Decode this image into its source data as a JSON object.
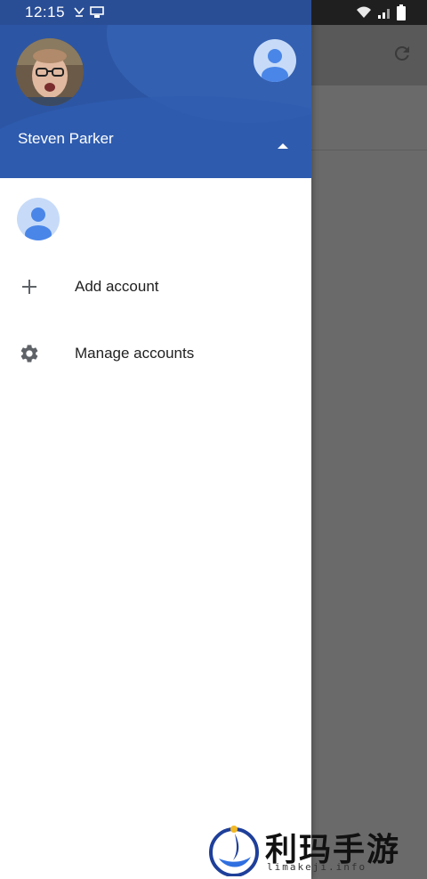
{
  "status_bar": {
    "time": "12:15",
    "left_icons": [
      "missed-call-icon",
      "cast-icon"
    ],
    "right_icons": [
      "wifi-icon",
      "signal-icon",
      "battery-icon"
    ]
  },
  "app_bar": {
    "refresh_icon": "refresh-icon"
  },
  "drawer": {
    "header": {
      "user_name": "Steven Parker",
      "background_color": "#2c56a4"
    },
    "menu": [
      {
        "label": "Add account",
        "icon": "plus-icon"
      },
      {
        "label": "Manage accounts",
        "icon": "gear-icon"
      }
    ]
  },
  "watermark": {
    "title": "利玛手游",
    "url": "limakeji.info"
  }
}
